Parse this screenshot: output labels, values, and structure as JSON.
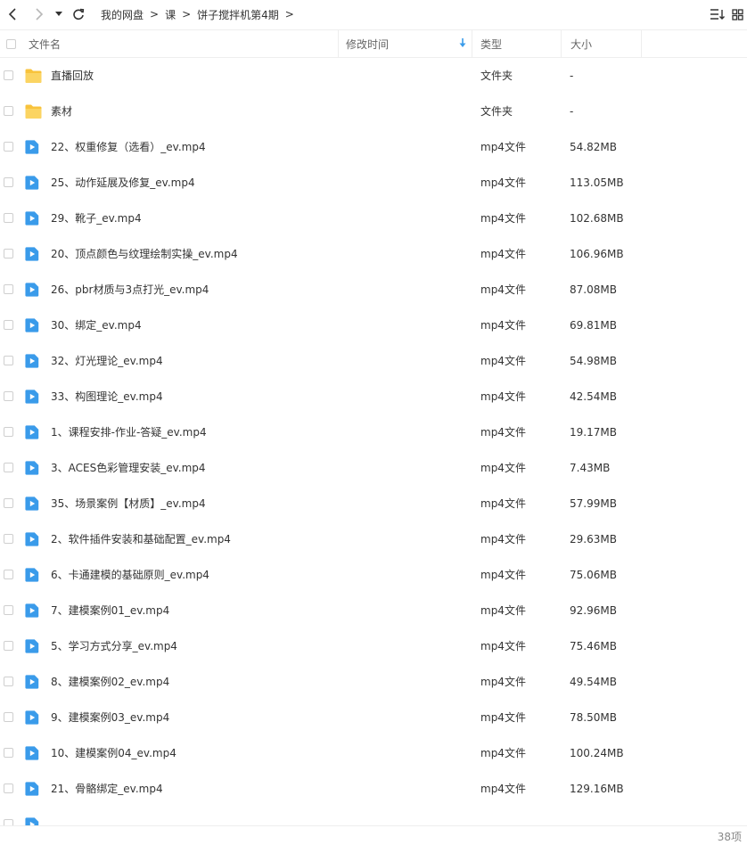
{
  "toolbar": {
    "breadcrumb": [
      "我的网盘",
      "课",
      "饼子搅拌机第4期"
    ],
    "separator": ">"
  },
  "header": {
    "name": "文件名",
    "mtime": "修改时间",
    "type": "类型",
    "size": "大小"
  },
  "colors": {
    "folder": "#f8c33c",
    "video": "#3a9bea",
    "text": "#333333",
    "muted": "#888888",
    "border": "#eeeeee"
  },
  "files": [
    {
      "name": "直播回放",
      "type": "文件夹",
      "size": "-",
      "icon": "folder-icon"
    },
    {
      "name": "素材",
      "type": "文件夹",
      "size": "-",
      "icon": "folder-icon"
    },
    {
      "name": "22、权重修复（选看）_ev.mp4",
      "type": "mp4文件",
      "size": "54.82MB",
      "icon": "video-file-icon"
    },
    {
      "name": "25、动作延展及修复_ev.mp4",
      "type": "mp4文件",
      "size": "113.05MB",
      "icon": "video-file-icon"
    },
    {
      "name": "29、靴子_ev.mp4",
      "type": "mp4文件",
      "size": "102.68MB",
      "icon": "video-file-icon"
    },
    {
      "name": "20、顶点颜色与纹理绘制实操_ev.mp4",
      "type": "mp4文件",
      "size": "106.96MB",
      "icon": "video-file-icon"
    },
    {
      "name": "26、pbr材质与3点打光_ev.mp4",
      "type": "mp4文件",
      "size": "87.08MB",
      "icon": "video-file-icon"
    },
    {
      "name": "30、绑定_ev.mp4",
      "type": "mp4文件",
      "size": "69.81MB",
      "icon": "video-file-icon"
    },
    {
      "name": "32、灯光理论_ev.mp4",
      "type": "mp4文件",
      "size": "54.98MB",
      "icon": "video-file-icon"
    },
    {
      "name": "33、构图理论_ev.mp4",
      "type": "mp4文件",
      "size": "42.54MB",
      "icon": "video-file-icon"
    },
    {
      "name": "1、课程安排-作业-答疑_ev.mp4",
      "type": "mp4文件",
      "size": "19.17MB",
      "icon": "video-file-icon"
    },
    {
      "name": "3、ACES色彩管理安装_ev.mp4",
      "type": "mp4文件",
      "size": "7.43MB",
      "icon": "video-file-icon"
    },
    {
      "name": "35、场景案例【材质】_ev.mp4",
      "type": "mp4文件",
      "size": "57.99MB",
      "icon": "video-file-icon"
    },
    {
      "name": "2、软件插件安装和基础配置_ev.mp4",
      "type": "mp4文件",
      "size": "29.63MB",
      "icon": "video-file-icon"
    },
    {
      "name": "6、卡通建模的基础原则_ev.mp4",
      "type": "mp4文件",
      "size": "75.06MB",
      "icon": "video-file-icon"
    },
    {
      "name": "7、建模案例01_ev.mp4",
      "type": "mp4文件",
      "size": "92.96MB",
      "icon": "video-file-icon"
    },
    {
      "name": "5、学习方式分享_ev.mp4",
      "type": "mp4文件",
      "size": "75.46MB",
      "icon": "video-file-icon"
    },
    {
      "name": "8、建模案例02_ev.mp4",
      "type": "mp4文件",
      "size": "49.54MB",
      "icon": "video-file-icon"
    },
    {
      "name": "9、建模案例03_ev.mp4",
      "type": "mp4文件",
      "size": "78.50MB",
      "icon": "video-file-icon"
    },
    {
      "name": "10、建模案例04_ev.mp4",
      "type": "mp4文件",
      "size": "100.24MB",
      "icon": "video-file-icon"
    },
    {
      "name": "21、骨骼绑定_ev.mp4",
      "type": "mp4文件",
      "size": "129.16MB",
      "icon": "video-file-icon"
    },
    {
      "name": "",
      "type": "",
      "size": "",
      "icon": "video-file-icon"
    }
  ],
  "status": {
    "count": "38项"
  }
}
